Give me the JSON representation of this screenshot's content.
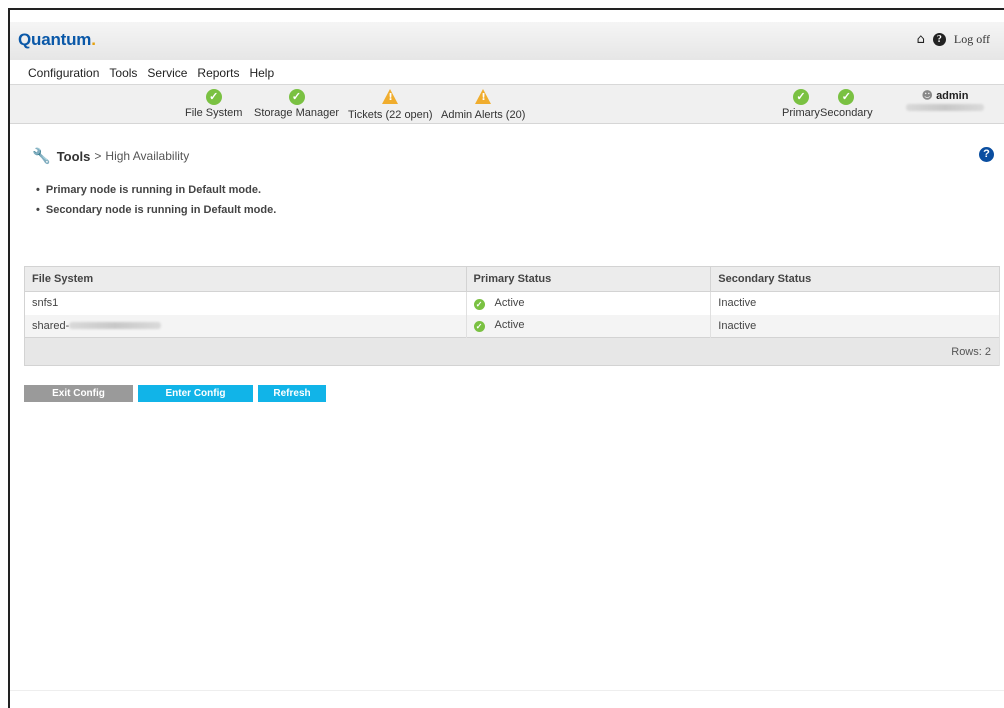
{
  "header": {
    "logo_text": "Quantum",
    "logo_dot": ".",
    "logoff_label": "Log off"
  },
  "menu": [
    "Configuration",
    "Tools",
    "Service",
    "Reports",
    "Help"
  ],
  "status": {
    "file_system": "File System",
    "storage_manager": "Storage Manager",
    "tickets": "Tickets (22 open)",
    "admin_alerts": "Admin Alerts (20)",
    "primary": "Primary",
    "secondary": "Secondary",
    "user": "admin"
  },
  "breadcrumb": {
    "section": "Tools",
    "separator": ">",
    "page": "High Availability"
  },
  "messages": [
    "Primary node is running in Default mode.",
    "Secondary node is running in Default mode."
  ],
  "table": {
    "headers": [
      "File System",
      "Primary Status",
      "Secondary Status"
    ],
    "rows": [
      {
        "fs": "snfs1",
        "primary": "Active",
        "secondary": "Inactive"
      },
      {
        "fs": "shared-",
        "primary": "Active",
        "secondary": "Inactive"
      }
    ],
    "footer": "Rows: 2"
  },
  "buttons": {
    "exit": "Exit Config Mode",
    "enter": "Enter Config Mode",
    "refresh": "Refresh"
  },
  "colors": {
    "brand": "#0a58a8",
    "ok": "#7ac142",
    "warning": "#f0ad2e",
    "button_blue": "#11b4e8",
    "button_gray": "#9a9a9a",
    "help_blue": "#0a4ea0"
  },
  "icons": {
    "home": "home-icon",
    "help": "help-icon",
    "user": "user-icon",
    "tools": "wrench-icon"
  }
}
